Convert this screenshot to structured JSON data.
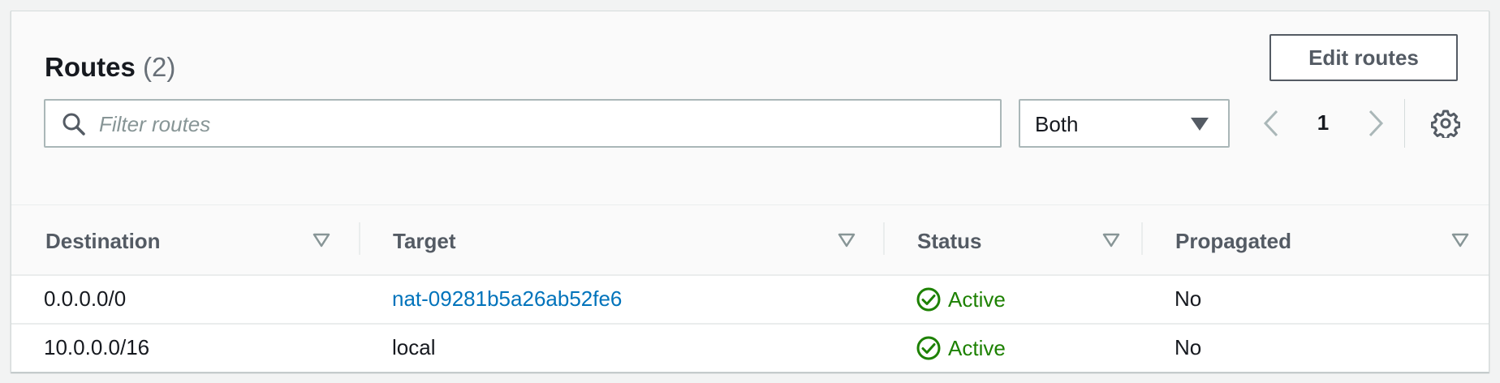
{
  "header": {
    "title": "Routes",
    "count": "(2)",
    "edit_button": "Edit routes"
  },
  "filter": {
    "placeholder": "Filter routes",
    "value": ""
  },
  "select": {
    "value": "Both"
  },
  "pagination": {
    "current_page": "1"
  },
  "table": {
    "columns": [
      "Destination",
      "Target",
      "Status",
      "Propagated"
    ],
    "rows": [
      {
        "destination": "0.0.0.0/0",
        "target": "nat-09281b5a26ab52fe6",
        "status": "Active",
        "propagated": "No"
      },
      {
        "destination": "10.0.0.0/16",
        "target": "local",
        "status": "Active",
        "propagated": "No"
      }
    ]
  },
  "colors": {
    "link": "#0073bb",
    "success": "#1d8102",
    "header_text": "#545b64"
  },
  "icons": [
    "search-icon",
    "caret-down-icon",
    "chevron-left-icon",
    "chevron-right-icon",
    "gear-icon",
    "sort-icon",
    "status-check-icon"
  ]
}
